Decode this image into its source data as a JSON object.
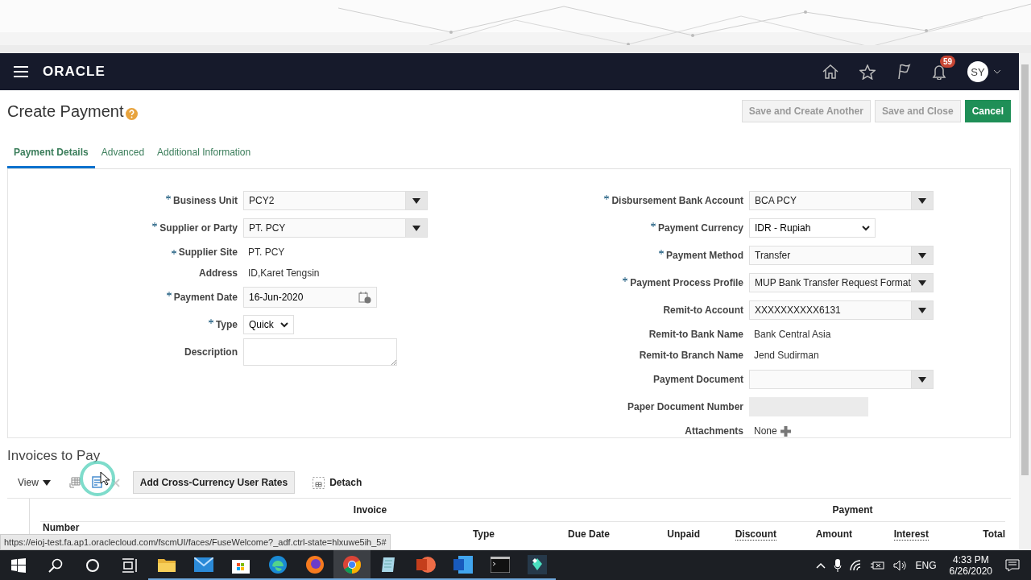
{
  "header": {
    "logo": "ORACLE",
    "notification_count": "59",
    "user_initials": "SY"
  },
  "page": {
    "title": "Create Payment",
    "buttons": [
      {
        "label": "Save and Create Another",
        "kind": "secondary",
        "disabled": true
      },
      {
        "label": "Save and Close",
        "kind": "secondary",
        "disabled": true
      },
      {
        "label": "Cancel",
        "kind": "primary",
        "disabled": false
      }
    ],
    "tabs": [
      {
        "label": "Payment Details",
        "selected": true
      },
      {
        "label": "Advanced",
        "selected": false
      },
      {
        "label": "Additional Information",
        "selected": false
      }
    ]
  },
  "form": {
    "left_fields": [
      {
        "label": "Business Unit",
        "required": true,
        "kind": "lov",
        "value": "PCY2"
      },
      {
        "label": "Supplier or Party",
        "required": true,
        "kind": "lov",
        "value": "PT. PCY"
      },
      {
        "label": "Supplier Site",
        "required": true,
        "kind": "text",
        "value": "PT. PCY"
      },
      {
        "label": "Address",
        "required": false,
        "kind": "text",
        "value": "ID,Karet Tengsin"
      },
      {
        "label": "Payment Date",
        "required": true,
        "kind": "date",
        "value": "16-Jun-2020"
      },
      {
        "label": "Type",
        "required": true,
        "kind": "select",
        "value": "Quick"
      },
      {
        "label": "Description",
        "required": false,
        "kind": "textarea"
      }
    ],
    "right_fields": [
      {
        "label": "Disbursement Bank Account",
        "required": true,
        "kind": "lov",
        "value": "BCA PCY"
      },
      {
        "label": "Payment Currency",
        "required": true,
        "kind": "select",
        "value": "IDR - Rupiah"
      },
      {
        "label": "Payment Method",
        "required": true,
        "kind": "lov",
        "value": "Transfer"
      },
      {
        "label": "Payment Process Profile",
        "required": true,
        "kind": "lov",
        "value": "MUP Bank Transfer Request Format"
      },
      {
        "label": "Remit-to Account",
        "required": false,
        "kind": "lov",
        "value": "XXXXXXXXXX6131"
      },
      {
        "label": "Remit-to Bank Name",
        "required": false,
        "kind": "text",
        "value": "Bank Central Asia"
      },
      {
        "label": "Remit-to Branch Name",
        "required": false,
        "kind": "text",
        "value": "Jend Sudirman"
      },
      {
        "label": "Payment Document",
        "required": false,
        "kind": "lov"
      },
      {
        "label": "Paper Document Number",
        "required": false,
        "kind": "readonly"
      },
      {
        "label": "Attachments",
        "required": false,
        "kind": "attachment",
        "value": "None"
      }
    ]
  },
  "invoices": {
    "title": "Invoices to Pay",
    "view_menu": "View",
    "rates_button": "Add Cross-Currency User Rates",
    "detach": "Detach",
    "groups": [
      "Invoice",
      "Payment"
    ],
    "columns": [
      {
        "label": "Number",
        "help_hint": false
      },
      {
        "label": "Type",
        "help_hint": false
      },
      {
        "label": "Due Date",
        "help_hint": false
      },
      {
        "label": "Unpaid",
        "help_hint": false
      },
      {
        "label": "Discount",
        "help_hint": true
      },
      {
        "label": "Amount",
        "help_hint": false
      },
      {
        "label": "Interest",
        "help_hint": true
      },
      {
        "label": "Total",
        "help_hint": false
      }
    ]
  },
  "status_url": "https://eioj-test.fa.ap1.oraclecloud.com/fscmUI/faces/FuseWelcome?_adf.ctrl-state=hlxuwe5ih_5#",
  "taskbar": {
    "apps": [
      {
        "kind": "explorer",
        "selected": false
      },
      {
        "kind": "mail",
        "selected": false
      },
      {
        "kind": "store",
        "selected": false
      },
      {
        "kind": "edge",
        "selected": false
      },
      {
        "kind": "firefox",
        "selected": false
      },
      {
        "kind": "chrome",
        "selected": true
      },
      {
        "kind": "notepad",
        "selected": false
      },
      {
        "kind": "powerpoint",
        "selected": false
      },
      {
        "kind": "word",
        "selected": false
      },
      {
        "kind": "terminal",
        "selected": false
      },
      {
        "kind": "filmora",
        "selected": false
      }
    ],
    "language": "ENG",
    "time": "4:33 PM",
    "date": "6/26/2020"
  }
}
